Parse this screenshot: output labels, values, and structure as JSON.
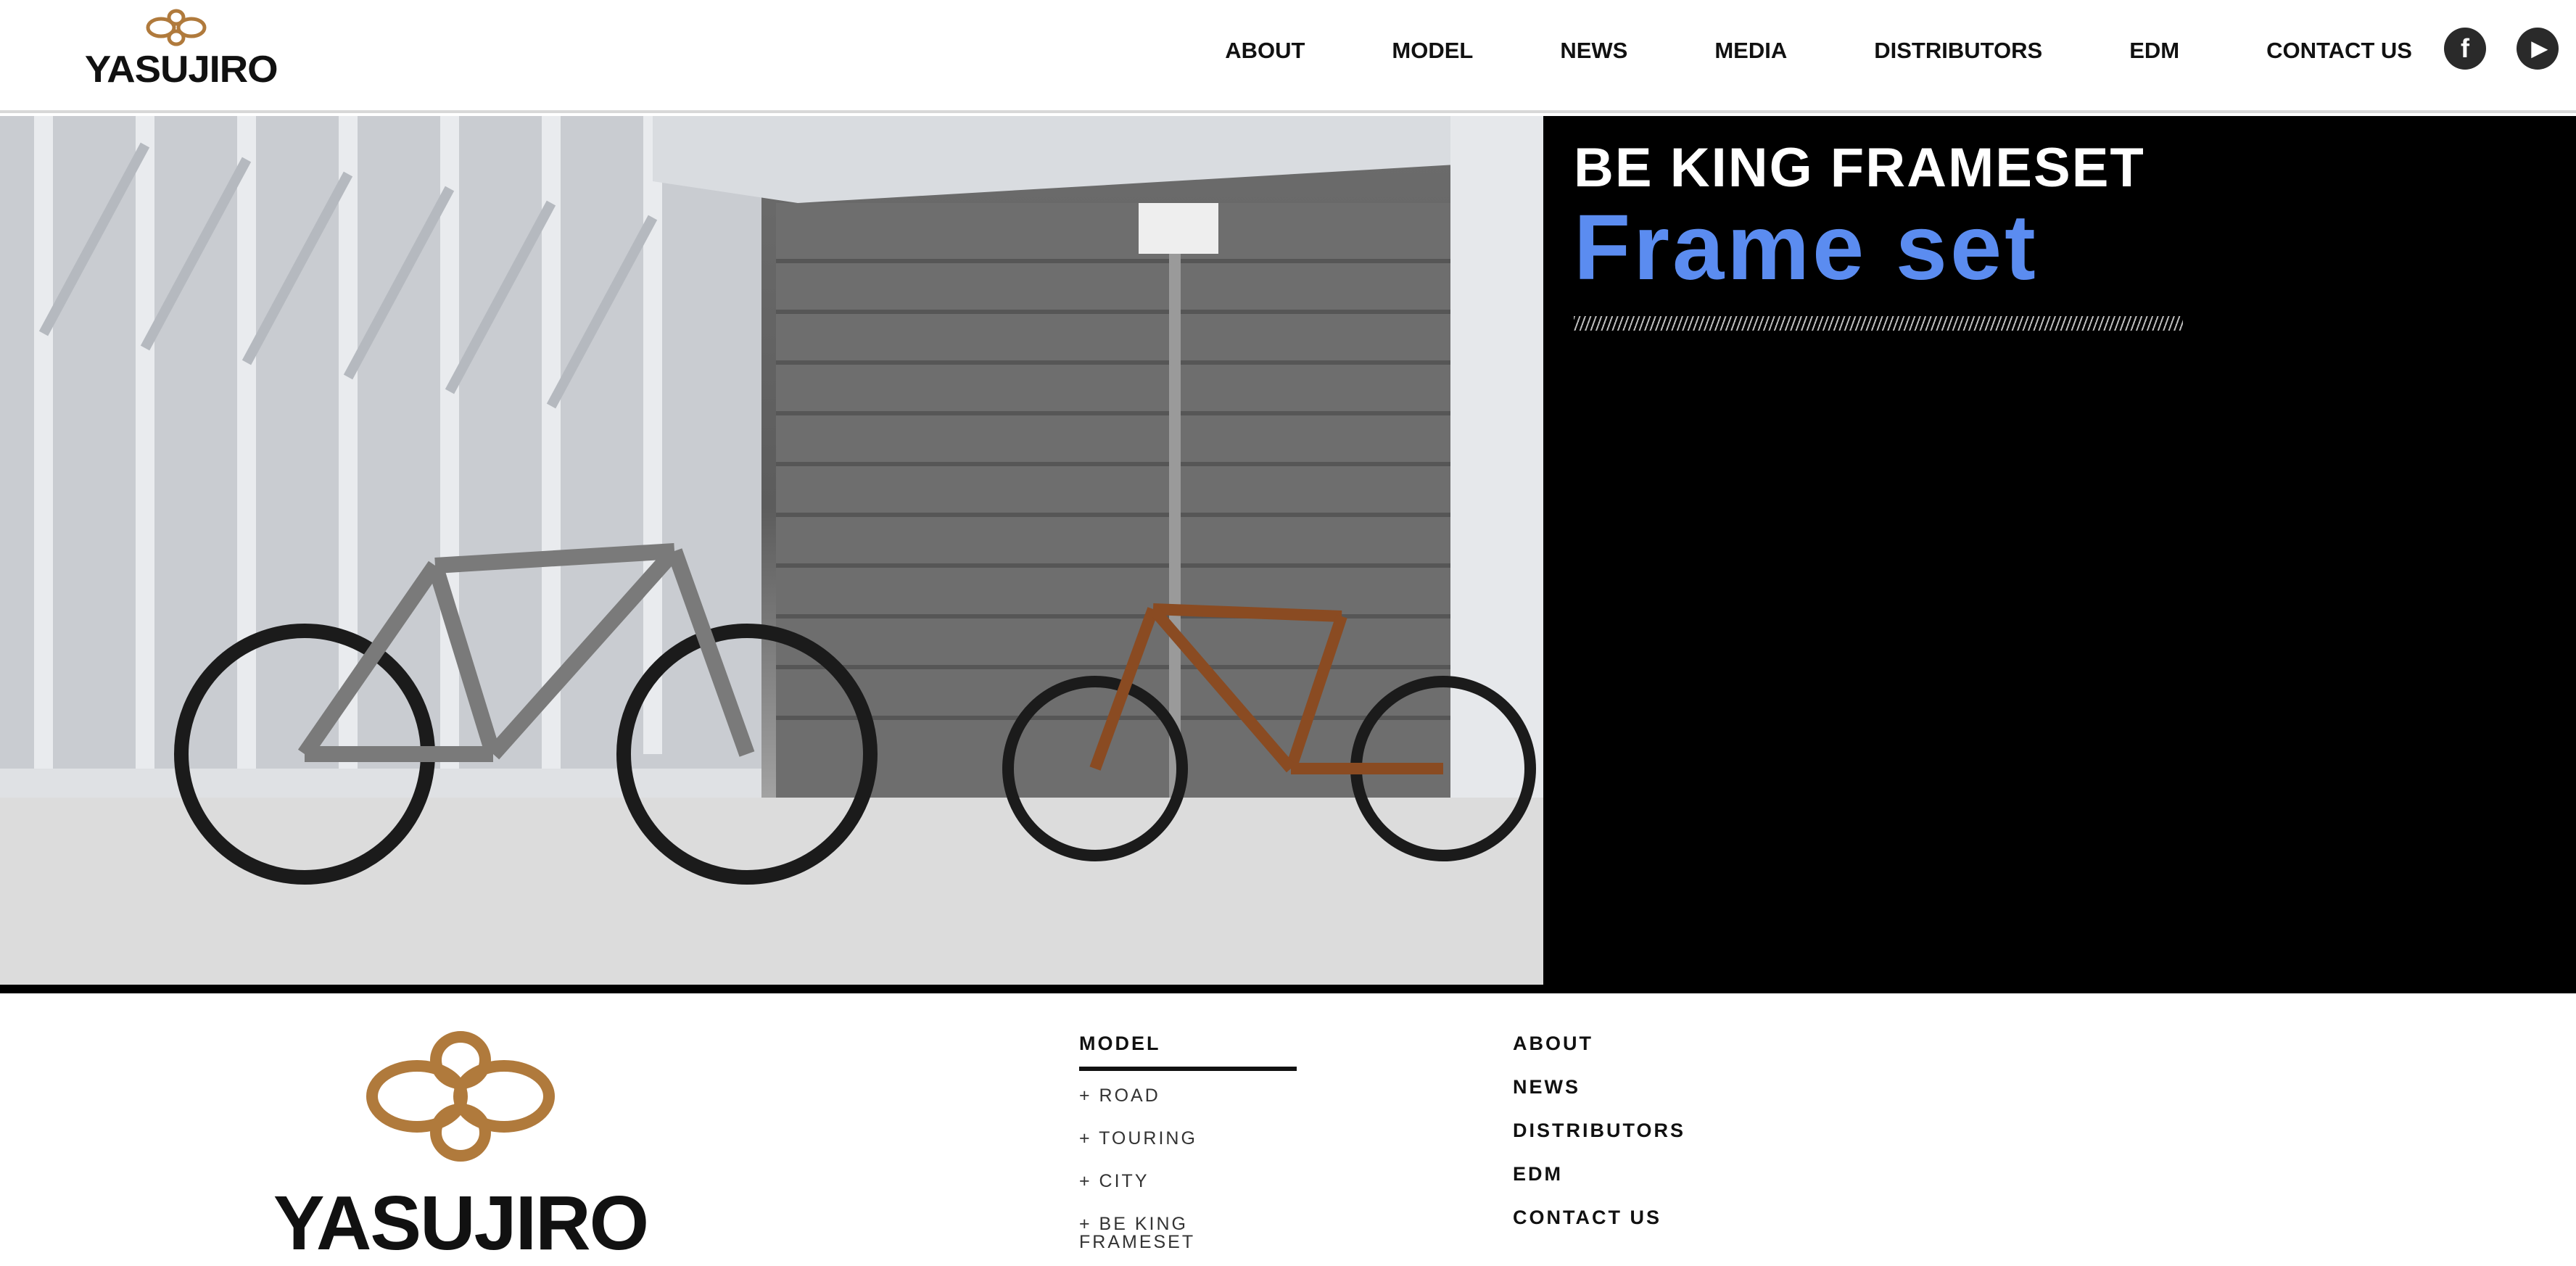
{
  "brand": {
    "name": "YASUJIRO",
    "logo_icon": "infinity-knot-icon"
  },
  "nav": [
    "ABOUT",
    "MODEL",
    "NEWS",
    "MEDIA",
    "DISTRIBUTORS",
    "EDM",
    "CONTACT US"
  ],
  "social": [
    {
      "icon": "facebook-icon",
      "glyph": "f"
    },
    {
      "icon": "youtube-icon",
      "glyph": "▶"
    }
  ],
  "hero": {
    "title": "BE KING FRAMESET",
    "subtitle": "Frame set",
    "accent_color": "#5b8cf0"
  },
  "footer": {
    "model_heading": "MODEL",
    "model_items": [
      "+ ROAD",
      "+ TOURING",
      "+ CITY",
      "+ BE KING FRAMESET"
    ],
    "links": [
      "ABOUT",
      "NEWS",
      "DISTRIBUTORS",
      "EDM",
      "CONTACT US"
    ]
  },
  "colors": {
    "logo_bronze": "#b07a3c",
    "hero_bg": "#000000"
  }
}
